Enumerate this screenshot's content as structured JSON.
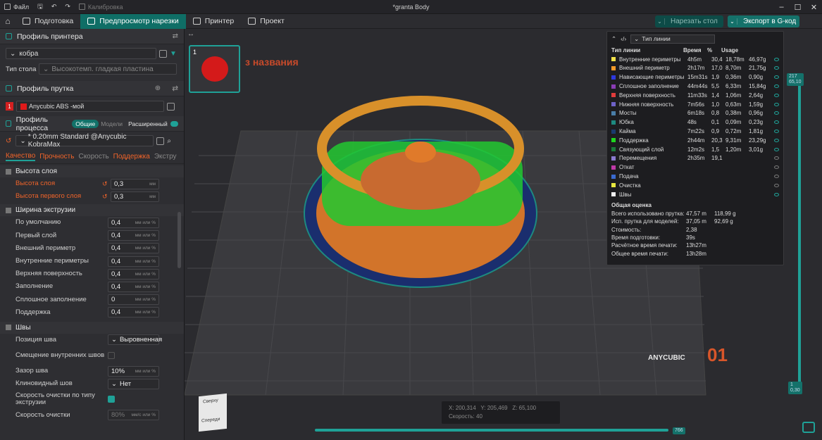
{
  "menu": {
    "file": "Файл",
    "calibration": "Калибровка"
  },
  "window_title": "*granta Body",
  "tabs": [
    {
      "label": "Подготовка"
    },
    {
      "label": "Предпросмотр нарезки"
    },
    {
      "label": "Принтер"
    },
    {
      "label": "Проект"
    }
  ],
  "actions": {
    "slice": "Нарезать стол",
    "export": "Экспорт в G-код"
  },
  "printer": {
    "header": "Профиль принтера",
    "name": "кобра",
    "plate_label": "Тип стола",
    "plate_value": "Высокотемп. гладкая пластина"
  },
  "filament": {
    "header": "Профиль прутка",
    "index": "1",
    "name": "Anycubic ABS -мой"
  },
  "process": {
    "header": "Профиль процесса",
    "mode_general": "Общие",
    "mode_models": "Модели",
    "advanced": "Расширенный",
    "preset": "* 0.20mm Standard @Anycubic KobraMax"
  },
  "subtabs": [
    "Качество",
    "Прочность",
    "Скорость",
    "Поддержка",
    "Экстру"
  ],
  "groups": {
    "layer": {
      "title": "Высота слоя",
      "params": [
        {
          "label": "Высота слоя",
          "value": "0,3",
          "unit": "мм"
        },
        {
          "label": "Высота первого слоя",
          "value": "0,3",
          "unit": "мм"
        }
      ]
    },
    "width": {
      "title": "Ширина экструзии",
      "params": [
        {
          "label": "По умолчанию",
          "value": "0,4",
          "unit": "мм или %"
        },
        {
          "label": "Первый слой",
          "value": "0,4",
          "unit": "мм или %"
        },
        {
          "label": "Внешний периметр",
          "value": "0,4",
          "unit": "мм или %"
        },
        {
          "label": "Внутренние периметры",
          "value": "0,4",
          "unit": "мм или %"
        },
        {
          "label": "Верхняя поверхность",
          "value": "0,4",
          "unit": "мм или %"
        },
        {
          "label": "Заполнение",
          "value": "0,4",
          "unit": "мм или %"
        },
        {
          "label": "Сплошное заполнение",
          "value": "0",
          "unit": "мм или %"
        },
        {
          "label": "Поддержка",
          "value": "0,4",
          "unit": "мм или %"
        }
      ]
    },
    "seam": {
      "title": "Швы",
      "position_label": "Позиция шва",
      "position_value": "Выровненная",
      "inner_label": "Смещение внутренних швов",
      "gap_label": "Зазор шва",
      "gap_value": "10%",
      "gap_unit": "мм или %",
      "wedge_label": "Клиновидный шов",
      "wedge_value": "Нет",
      "wipe_label": "Скорость очистки по типу экструзии",
      "wipe_speed_label": "Скорость очистки",
      "wipe_speed_value": "80%",
      "wipe_speed_unit": "мм/с или %"
    }
  },
  "plate": {
    "number": "1",
    "watermark": "з названия",
    "brand": "ANYCUBIC",
    "plate_no": "01"
  },
  "legend": {
    "combo": "Тип линии",
    "headers": [
      "Тип линии",
      "Время",
      "%",
      "Usage"
    ],
    "rows": [
      {
        "name": "Внутренние периметры",
        "time": "4h5m",
        "pct": "30,4",
        "len": "18,78m",
        "w": "46,97g",
        "color": "#f2e24a",
        "on": true
      },
      {
        "name": "Внешний периметр",
        "time": "2h17m",
        "pct": "17,0",
        "len": "8,70m",
        "w": "21,75g",
        "color": "#f59b2a",
        "on": true
      },
      {
        "name": "Нависающие периметры",
        "time": "15m31s",
        "pct": "1,9",
        "len": "0,36m",
        "w": "0,90g",
        "color": "#2d39e0",
        "on": true
      },
      {
        "name": "Сплошное заполнение",
        "time": "44m44s",
        "pct": "5,5",
        "len": "6,33m",
        "w": "15,84g",
        "color": "#8a3cb4",
        "on": true
      },
      {
        "name": "Верхняя поверхность",
        "time": "11m33s",
        "pct": "1,4",
        "len": "1,06m",
        "w": "2,64g",
        "color": "#e03c3c",
        "on": true
      },
      {
        "name": "Нижняя поверхность",
        "time": "7m56s",
        "pct": "1,0",
        "len": "0,63m",
        "w": "1,59g",
        "color": "#6e62c8",
        "on": true
      },
      {
        "name": "Мосты",
        "time": "6m18s",
        "pct": "0,8",
        "len": "0,38m",
        "w": "0,96g",
        "color": "#4a7ea8",
        "on": true
      },
      {
        "name": "Юбка",
        "time": "48s",
        "pct": "0,1",
        "len": "0,09m",
        "w": "0,23g",
        "color": "#1d8a80",
        "on": true
      },
      {
        "name": "Кайма",
        "time": "7m22s",
        "pct": "0,9",
        "len": "0,72m",
        "w": "1,81g",
        "color": "#1a3a6e",
        "on": true
      },
      {
        "name": "Поддержка",
        "time": "2h44m",
        "pct": "20,3",
        "len": "9,31m",
        "w": "23,29g",
        "color": "#1fd61f",
        "on": true
      },
      {
        "name": "Связующий слой",
        "time": "12m2s",
        "pct": "1,5",
        "len": "1,20m",
        "w": "3,01g",
        "color": "#1a7a3a",
        "on": true
      },
      {
        "name": "Перемещения",
        "time": "2h35m",
        "pct": "19,1",
        "len": "",
        "w": "",
        "color": "#8a7ad0",
        "on": false
      },
      {
        "name": "Откат",
        "time": "",
        "pct": "",
        "len": "",
        "w": "",
        "color": "#c03aa8",
        "on": false
      },
      {
        "name": "Подача",
        "time": "",
        "pct": "",
        "len": "",
        "w": "",
        "color": "#3a6ad0",
        "on": false
      },
      {
        "name": "Очистка",
        "time": "",
        "pct": "",
        "len": "",
        "w": "",
        "color": "#e8e840",
        "on": false
      },
      {
        "name": "Швы",
        "time": "",
        "pct": "",
        "len": "",
        "w": "",
        "color": "#f0f0f0",
        "on": true
      }
    ],
    "summary_title": "Общая оценка",
    "summary": [
      {
        "k": "Всего использовано прутка:",
        "v1": "47,57 m",
        "v2": "118,99 g"
      },
      {
        "k": "Исп. прутка для моделей:",
        "v1": "37,05 m",
        "v2": "92,69 g"
      },
      {
        "k": "Стоимость:",
        "v1": "2,38",
        "v2": ""
      },
      {
        "k": "Время подготовки:",
        "v1": "39s",
        "v2": ""
      },
      {
        "k": "Расчётное время печати:",
        "v1": "13h27m",
        "v2": ""
      },
      {
        "k": "Общее время печати:",
        "v1": "13h28m",
        "v2": ""
      }
    ]
  },
  "coords": {
    "x": "X: 200,314",
    "y": "Y: 205,469",
    "z": "Z: 65,100",
    "speed": "Скорость: 40"
  },
  "sliders": {
    "h_value": "766",
    "v_top_a": "217",
    "v_top_b": "65,10",
    "v_bot_a": "1",
    "v_bot_b": "0,30"
  },
  "cube": {
    "top": "Сверху",
    "front": "Спереди"
  }
}
